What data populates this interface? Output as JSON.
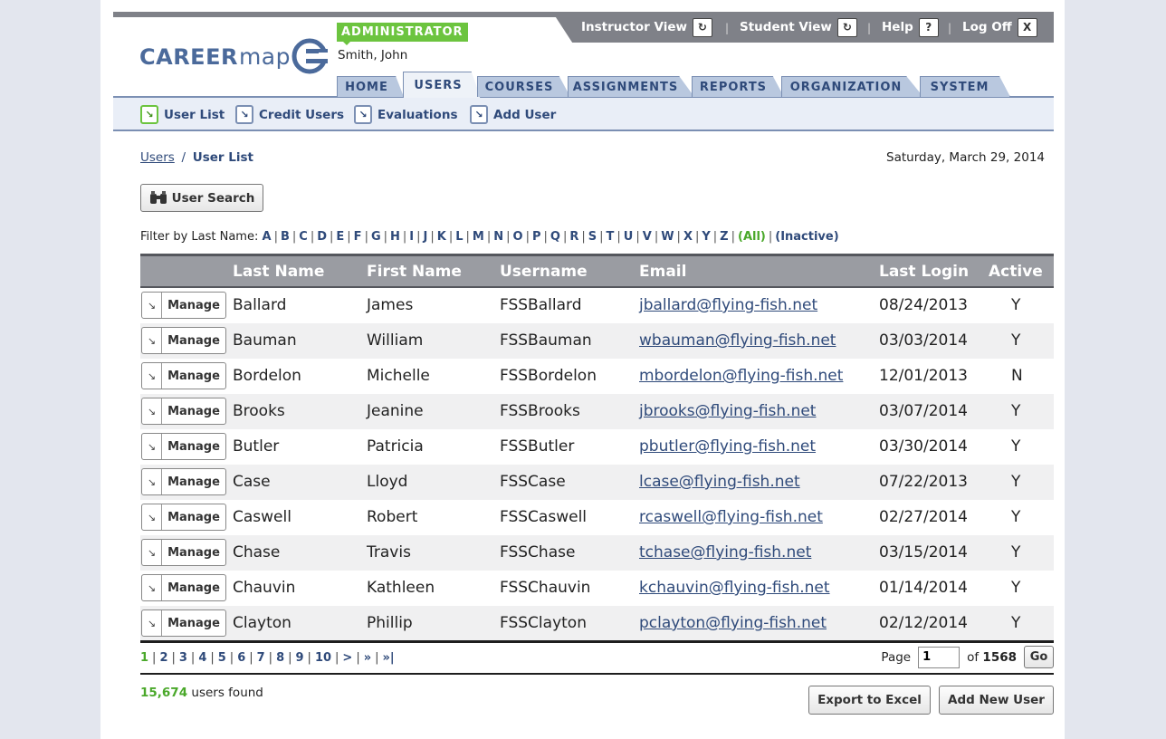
{
  "header": {
    "util_links": [
      "Instructor View",
      "Student View",
      "Help",
      "Log Off"
    ],
    "util_icons": [
      "↻",
      "↻",
      "?",
      "X"
    ],
    "logo_main": "CAREER",
    "logo_accent": "map",
    "role_badge": "ADMINISTRATOR",
    "user_name": "Smith, John"
  },
  "tabs": [
    "HOME",
    "USERS",
    "COURSES",
    "ASSIGNMENTS",
    "REPORTS",
    "ORGANIZATION",
    "SYSTEM"
  ],
  "subnav": [
    "User List",
    "Credit Users",
    "Evaluations",
    "Add User"
  ],
  "breadcrumb": {
    "link": "Users",
    "separator": "/",
    "current": "User List"
  },
  "date": "Saturday, March 29, 2014",
  "user_search_label": "User Search",
  "filter": {
    "label": "Filter by Last Name:",
    "letters": [
      "A",
      "B",
      "C",
      "D",
      "E",
      "F",
      "G",
      "H",
      "I",
      "J",
      "K",
      "L",
      "M",
      "N",
      "O",
      "P",
      "Q",
      "R",
      "S",
      "T",
      "U",
      "V",
      "W",
      "X",
      "Y",
      "Z"
    ],
    "all": "(All)",
    "inactive": "(Inactive)"
  },
  "table": {
    "headers": [
      "Last Name",
      "First Name",
      "Username",
      "Email",
      "Last Login",
      "Active"
    ],
    "manage_label": "Manage",
    "rows": [
      [
        "Ballard",
        "James",
        "FSSBallard",
        "jballard@flying-fish.net",
        "08/24/2013",
        "Y"
      ],
      [
        "Bauman",
        "William",
        "FSSBauman",
        "wbauman@flying-fish.net",
        "03/03/2014",
        "Y"
      ],
      [
        "Bordelon",
        "Michelle",
        "FSSBordelon",
        "mbordelon@flying-fish.net",
        "12/01/2013",
        "N"
      ],
      [
        "Brooks",
        "Jeanine",
        "FSSBrooks",
        "jbrooks@flying-fish.net",
        "03/07/2014",
        "Y"
      ],
      [
        "Butler",
        "Patricia",
        "FSSButler",
        "pbutler@flying-fish.net",
        "03/30/2014",
        "Y"
      ],
      [
        "Case",
        "Lloyd",
        "FSSCase",
        "lcase@flying-fish.net",
        "07/22/2013",
        "Y"
      ],
      [
        "Caswell",
        "Robert",
        "FSSCaswell",
        "rcaswell@flying-fish.net",
        "02/27/2014",
        "Y"
      ],
      [
        "Chase",
        "Travis",
        "FSSChase",
        "tchase@flying-fish.net",
        "03/15/2014",
        "Y"
      ],
      [
        "Chauvin",
        "Kathleen",
        "FSSChauvin",
        "kchauvin@flying-fish.net",
        "01/14/2014",
        "Y"
      ],
      [
        "Clayton",
        "Phillip",
        "FSSClayton",
        "pclayton@flying-fish.net",
        "02/12/2014",
        "Y"
      ]
    ]
  },
  "pager": {
    "pages": [
      "1",
      "2",
      "3",
      "4",
      "5",
      "6",
      "7",
      "8",
      "9",
      "10",
      ">",
      "»",
      "»|"
    ],
    "current": "1",
    "page_label": "Page",
    "page_value": "1",
    "of_label": "of",
    "total_pages": "1568",
    "go_label": "Go"
  },
  "footer": {
    "count": "15,674",
    "count_suffix": "users found",
    "export_label": "Export to Excel",
    "add_label": "Add New User"
  },
  "colors": {
    "accent_green": "#6cc43f",
    "link_blue": "#2f4a7a",
    "header_gray": "#9a9ca2"
  }
}
